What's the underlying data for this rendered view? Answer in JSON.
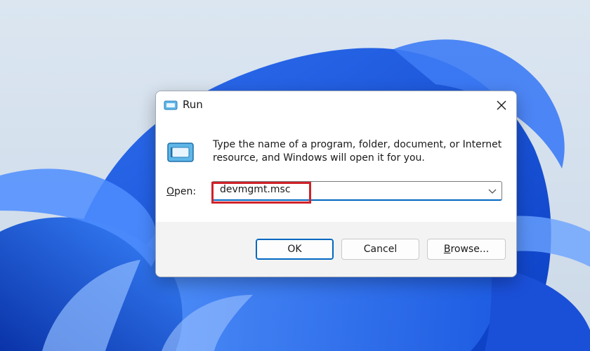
{
  "dialog": {
    "title": "Run",
    "description": "Type the name of a program, folder, document, or Internet resource, and Windows will open it for you.",
    "open_label_accel": "O",
    "open_label_rest": "pen:",
    "open_value": "devmgmt.msc",
    "buttons": {
      "ok": "OK",
      "cancel": "Cancel",
      "browse_accel": "B",
      "browse_rest": "rowse..."
    }
  },
  "icons": {
    "title": "run-icon",
    "main": "run-icon",
    "close": "close-icon",
    "dropdown": "chevron-down-icon"
  },
  "colors": {
    "accent": "#0067c0",
    "highlight": "#d0222a",
    "footer_bg": "#f3f3f3"
  }
}
